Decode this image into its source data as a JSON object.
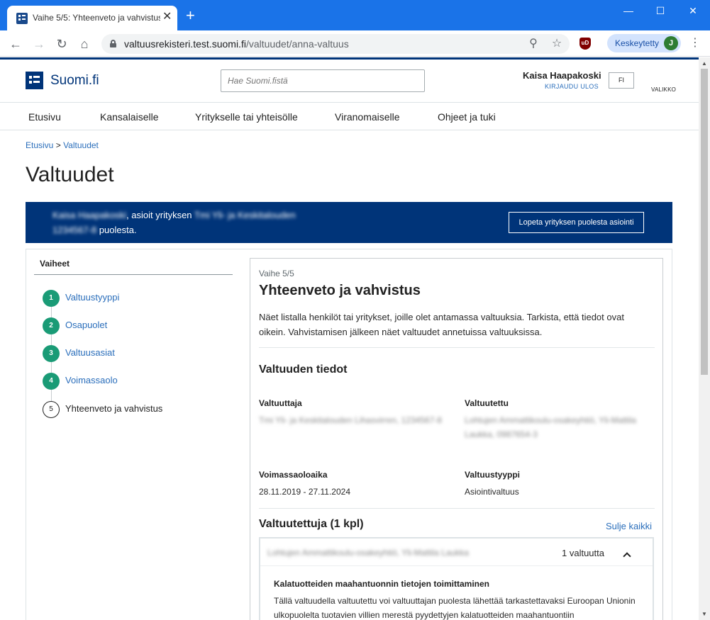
{
  "browser": {
    "tab_title": "Vaihe 5/5: Yhteenveto ja vahvistus",
    "url_host": "valtuusrekisteri.test.suomi.fi",
    "url_path": "/valtuudet/anna-valtuus",
    "profile_label": "Keskeytetty",
    "profile_initial": "J",
    "extension_badge": "uD"
  },
  "header": {
    "logo_text": "Suomi.fi",
    "search_placeholder": "Hae Suomi.fistä",
    "user_name": "Kaisa Haapakoski",
    "logout_label": "KIRJAUDU ULOS",
    "language": "FI",
    "menu_label": "VALIKKO"
  },
  "nav": {
    "items": [
      "Etusivu",
      "Kansalaiselle",
      "Yritykselle tai yhteisölle",
      "Viranomaiselle",
      "Ohjeet ja tuki"
    ]
  },
  "breadcrumb": {
    "home": "Etusivu",
    "separator": ">",
    "current": "Valtuudet"
  },
  "page_title": "Valtuudet",
  "banner": {
    "person_redacted": "Kaisa Haapakoski",
    "text_mid": ", asioit yrityksen",
    "company_redacted": "Tmi Yli- ja Keskitalouden",
    "company_id_redacted": "1234567-8",
    "text_end": "puolesta.",
    "stop_button": "Lopeta yrityksen puolesta asiointi"
  },
  "steps": {
    "title": "Vaiheet",
    "items": [
      {
        "number": "1",
        "label": "Valtuustyyppi"
      },
      {
        "number": "2",
        "label": "Osapuolet"
      },
      {
        "number": "3",
        "label": "Valtuusasiat"
      },
      {
        "number": "4",
        "label": "Voimassaolo"
      },
      {
        "number": "5",
        "label": "Yhteenveto ja vahvistus"
      }
    ]
  },
  "summary": {
    "phase": "Vaihe 5/5",
    "title": "Yhteenveto ja vahvistus",
    "intro": "Näet listalla henkilöt tai yritykset, joille olet antamassa valtuuksia. Tarkista, että tiedot ovat oikein. Vahvistamisen jälkeen näet valtuudet annetuissa valtuuksissa.",
    "section_title": "Valtuuden tiedot",
    "grantor_label": "Valtuuttaja",
    "grantor_value_redacted": "Tmi Yli- ja Keskitalouden Lihasvirren, 1234567-8",
    "grantee_label": "Valtuutettu",
    "grantee_value_redacted": "Lohtujen Ammattikoulu-osakeyhtiö, Yli-Mattila Laukka, 0987654-3",
    "validity_label": "Voimassaoloaika",
    "validity_value": "28.11.2019 - 27.11.2024",
    "type_label": "Valtuustyyppi",
    "type_value": "Asiointivaltuus"
  },
  "grantees": {
    "title": "Valtuutettuja (1 kpl)",
    "close_all": "Sulje kaikki",
    "entry_name_redacted": "Lohtujen Ammattikoulu-osakeyhtiö, Yli-Mattila Laukka",
    "entry_count": "1 valtuutta",
    "authorization_title": "Kalatuotteiden maahantuonnin tietojen toimittaminen",
    "authorization_desc": "Tällä valtuudella valtuutettu voi valtuuttajan puolesta lähettää tarkastettavaksi Euroopan Unionin ulkopuolelta tuotavien villien merestä pyydettyjen kalatuotteiden maahantuontiin"
  }
}
